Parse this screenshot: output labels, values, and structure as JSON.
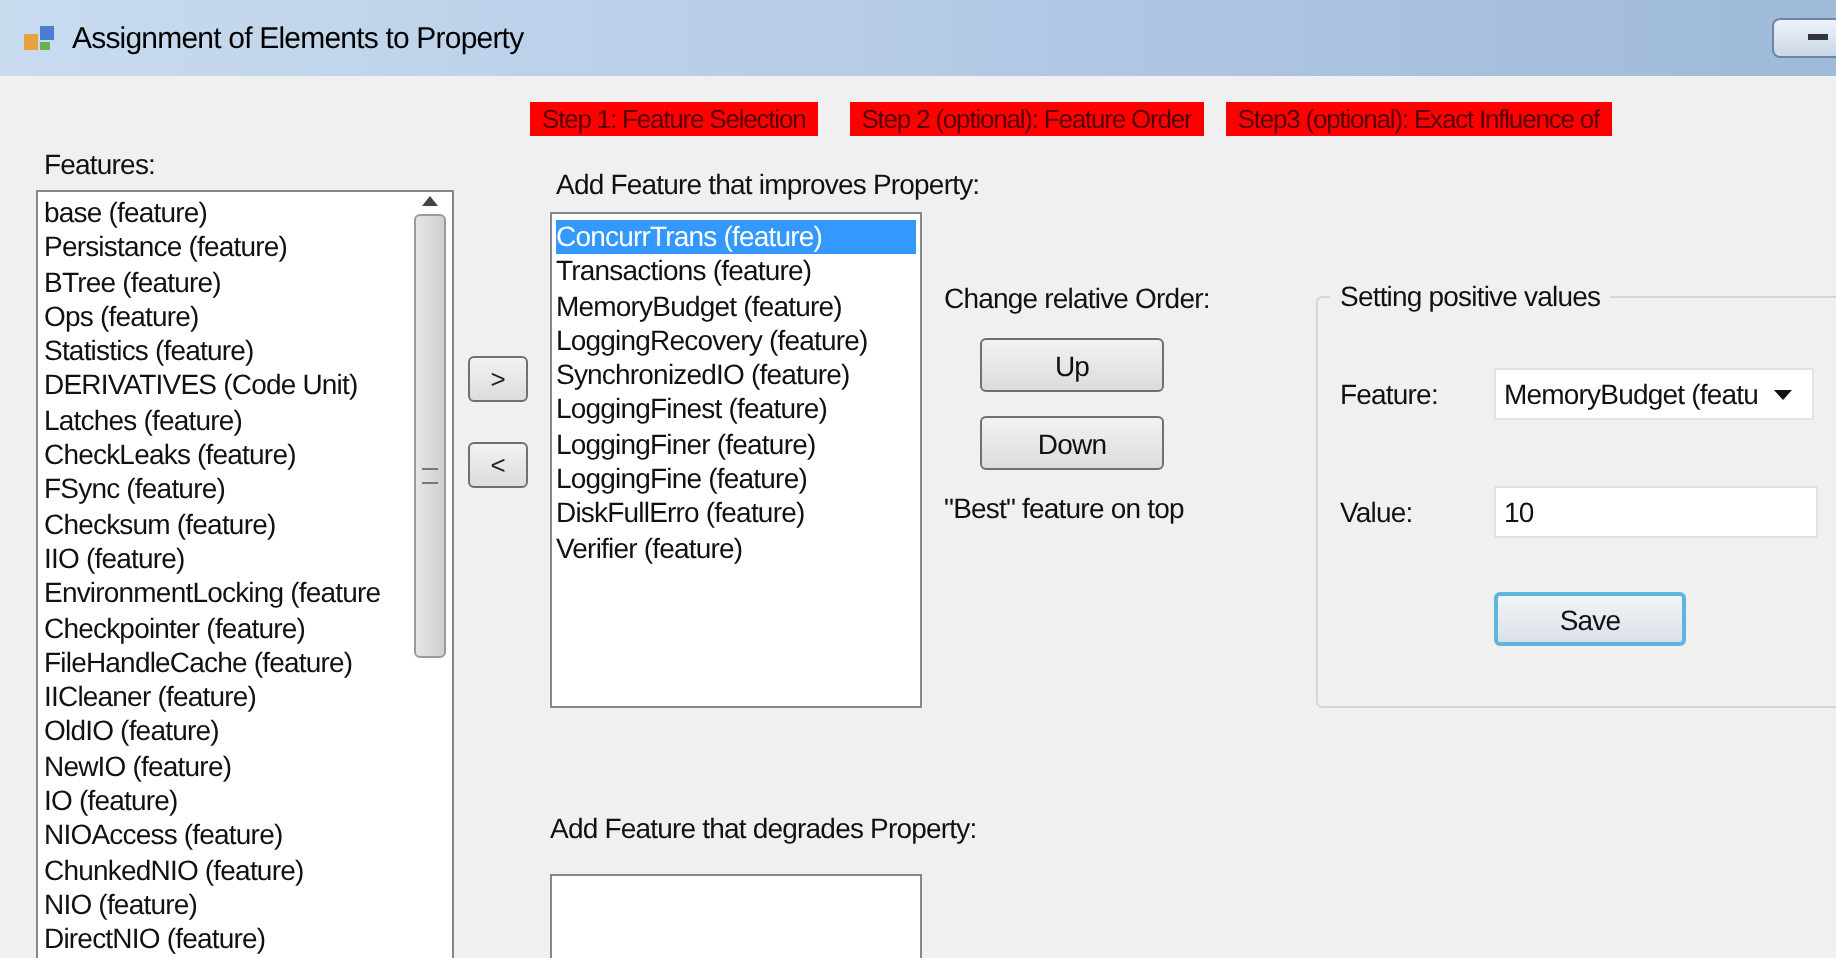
{
  "window": {
    "title": "Assignment of Elements to Property"
  },
  "steps": [
    "Step 1: Feature Selection",
    "Step 2 (optional): Feature Order",
    "Step3 (optional): Exact Influence of"
  ],
  "features": {
    "label": "Features:",
    "items": [
      {
        "text": "base (feature)",
        "selected": false
      },
      {
        "text": "Persistance (feature)",
        "selected": false
      },
      {
        "text": "BTree (feature)",
        "selected": false
      },
      {
        "text": "Ops (feature)",
        "selected": false
      },
      {
        "text": "Statistics (feature)",
        "selected": false
      },
      {
        "text": "DERIVATIVES (Code Unit)",
        "selected": false
      },
      {
        "text": "Latches (feature)",
        "selected": false
      },
      {
        "text": "CheckLeaks (feature)",
        "selected": false
      },
      {
        "text": "FSync (feature)",
        "selected": false
      },
      {
        "text": "Checksum (feature)",
        "selected": false
      },
      {
        "text": "IIO (feature)",
        "selected": false
      },
      {
        "text": "EnvironmentLocking (feature",
        "selected": false
      },
      {
        "text": "Checkpointer (feature)",
        "selected": false
      },
      {
        "text": "FileHandleCache (feature)",
        "selected": false
      },
      {
        "text": "IICleaner (feature)",
        "selected": false
      },
      {
        "text": "OldIO (feature)",
        "selected": false
      },
      {
        "text": "NewIO (feature)",
        "selected": false
      },
      {
        "text": "IO (feature)",
        "selected": false
      },
      {
        "text": "NIOAccess (feature)",
        "selected": false
      },
      {
        "text": "ChunkedNIO (feature)",
        "selected": false
      },
      {
        "text": "NIO (feature)",
        "selected": false
      },
      {
        "text": "DirectNIO (feature)",
        "selected": false
      }
    ]
  },
  "move_buttons": [
    ">",
    "<"
  ],
  "improves": {
    "label": "Add Feature that improves Property:",
    "items": [
      {
        "text": "ConcurrTrans (feature)",
        "selected": true
      },
      {
        "text": "Transactions (feature)",
        "selected": false
      },
      {
        "text": "MemoryBudget (feature)",
        "selected": false
      },
      {
        "text": "LoggingRecovery (feature)",
        "selected": false
      },
      {
        "text": "SynchronizedIO (feature)",
        "selected": false
      },
      {
        "text": "LoggingFinest (feature)",
        "selected": false
      },
      {
        "text": "LoggingFiner (feature)",
        "selected": false
      },
      {
        "text": "LoggingFine (feature)",
        "selected": false
      },
      {
        "text": "DiskFullErro (feature)",
        "selected": false
      },
      {
        "text": "Verifier (feature)",
        "selected": false
      }
    ]
  },
  "order": {
    "label": "Change relative Order:",
    "buttons": [
      "Up",
      "Down"
    ],
    "hint": "\"Best\" feature on top"
  },
  "degrades": {
    "label": "Add Feature that degrades Property:"
  },
  "settings": {
    "title": "Setting positive values",
    "feature_label": "Feature:",
    "feature_value": "MemoryBudget (featu",
    "value_label": "Value:",
    "value": "10",
    "save": "Save"
  }
}
